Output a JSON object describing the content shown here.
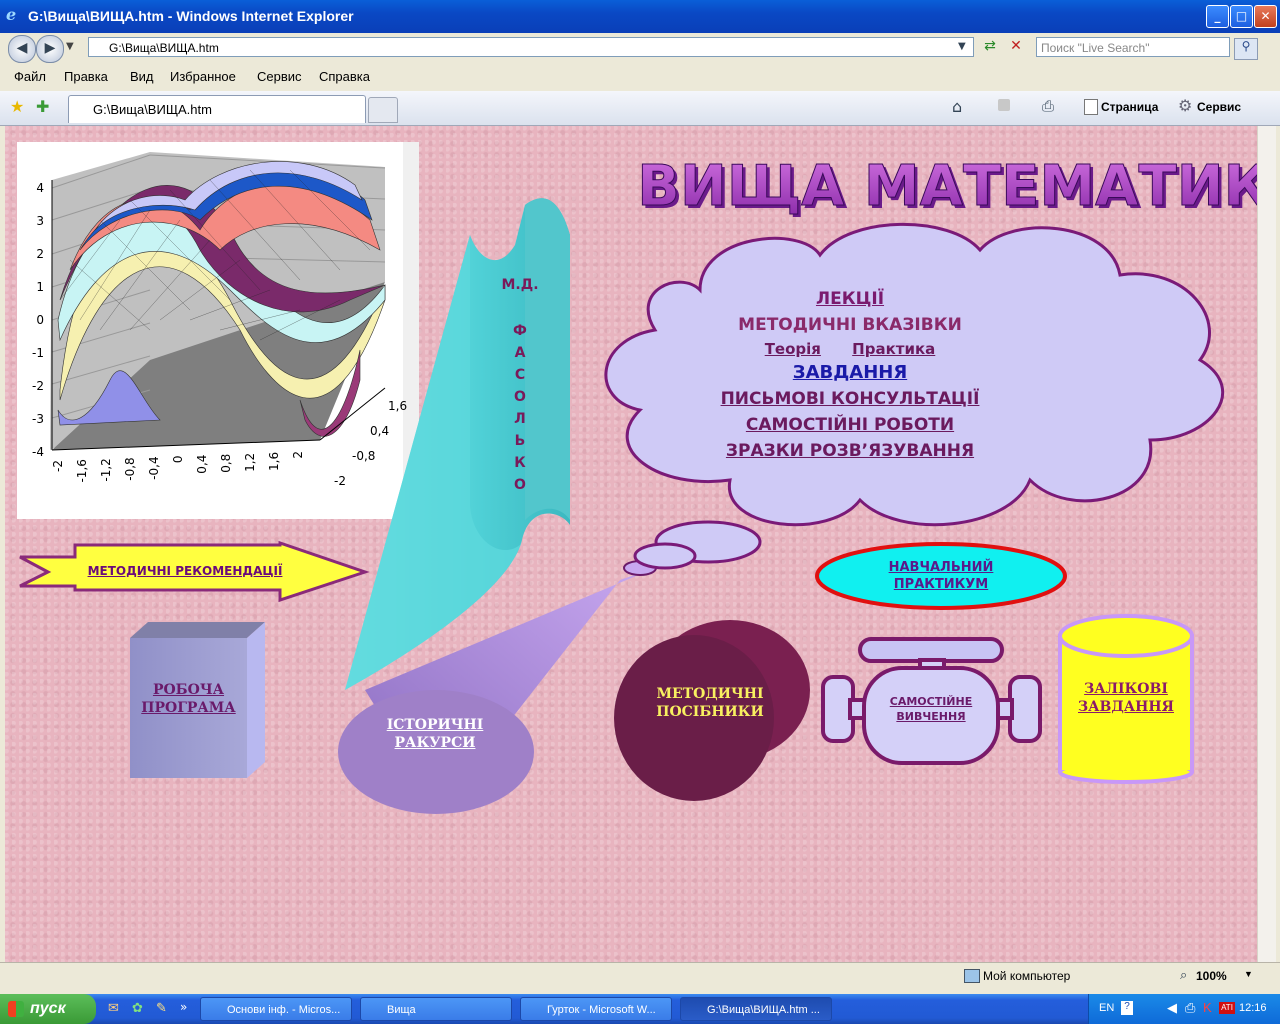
{
  "window": {
    "title": "G:\\Вища\\ВИЩА.htm - Windows Internet Explorer"
  },
  "address": {
    "url": "G:\\Вища\\ВИЩА.htm"
  },
  "search": {
    "placeholder": "Поиск \"Live Search\""
  },
  "menu": [
    "Файл",
    "Правка",
    "Вид",
    "Избранное",
    "Сервис",
    "Справка"
  ],
  "tab": {
    "label": "G:\\Вища\\ВИЩА.htm"
  },
  "toolbar": {
    "page_label": "Страница",
    "tools_label": "Сервис"
  },
  "page": {
    "title": "ВИЩА МАТЕМАТИКА",
    "author_initials": "М.Д.",
    "author_letters": [
      "Ф",
      "А",
      "С",
      "О",
      "Л",
      "Ь",
      "К",
      "О"
    ],
    "cloud_links": {
      "lectures": "ЛЕКЦІЇ",
      "guidelines": "МЕТОДИЧНІ ВКАЗІВКИ",
      "theory": "Теорія",
      "practice": "Практика",
      "tasks": "ЗАВДАННЯ",
      "consultations": "ПИСЬМОВІ КОНСУЛЬТАЦІЇ",
      "independent": "САМОСТІЙНІ РОБОТИ",
      "examples": "ЗРАЗКИ РОЗВ’ЯЗУВАННЯ"
    },
    "recommendations": "МЕТОДИЧНІ РЕКОМЕНДАЦІЇ",
    "practicum": [
      "НАВЧАЛЬНИЙ",
      "ПРАКТИКУМ"
    ],
    "program": [
      "РОБОЧА",
      "ПРОГРАМА"
    ],
    "history": [
      "ІСТОРИЧНІ",
      "РАКУРСИ"
    ],
    "manuals": [
      "МЕТОДИЧНІ",
      "ПОСІБНИКИ"
    ],
    "selfstudy": [
      "САМОСТІЙНЕ",
      "ВИВЧЕННЯ"
    ],
    "tests": [
      "ЗАЛІКОВІ",
      "ЗАВДАННЯ"
    ]
  },
  "graph": {
    "y_ticks": [
      "4",
      "3",
      "2",
      "1",
      "0",
      "-1",
      "-2",
      "-3",
      "-4"
    ],
    "x_ticks": [
      "-2",
      "-1,6",
      "-1,2",
      "-0,8",
      "-0,4",
      "0",
      "0,4",
      "0,8",
      "1,2",
      "1,6",
      "2"
    ],
    "z_ticks": [
      "1,6",
      "0,4",
      "-0,8",
      "-2"
    ]
  },
  "status": {
    "zone": "Мой компьютер",
    "zoom": "100%"
  },
  "taskbar": {
    "start": "пуск",
    "tasks": [
      "Основи інф. - Micros...",
      "Вища",
      "Гурток - Microsoft W...",
      "G:\\Вища\\ВИЩА.htm ..."
    ],
    "lang": "EN",
    "time": "12:16"
  }
}
